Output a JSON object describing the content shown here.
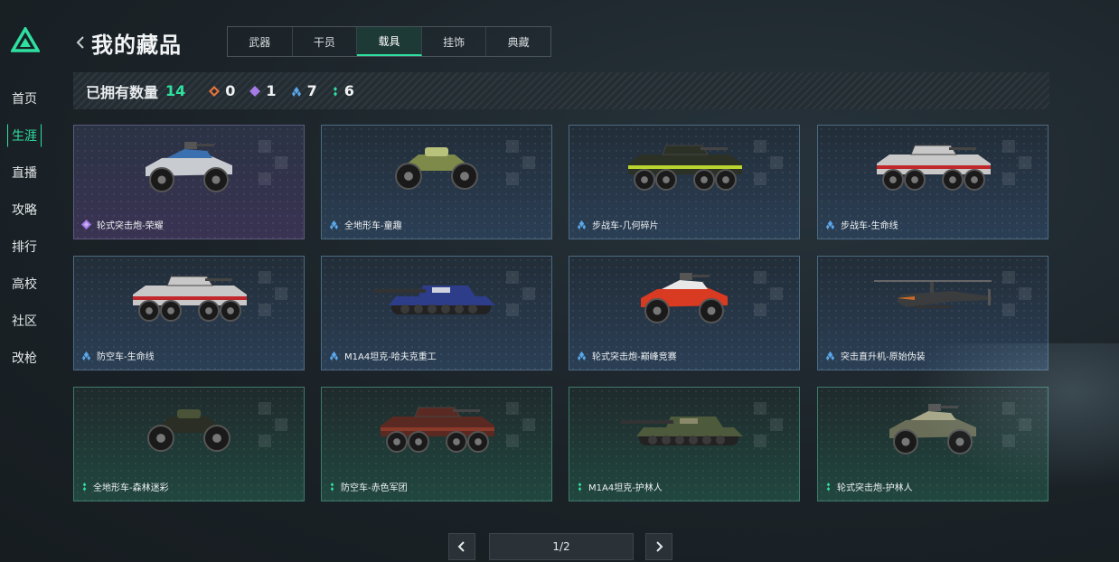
{
  "nav": {
    "items": [
      {
        "label": "首页",
        "active": false
      },
      {
        "label": "生涯",
        "active": true
      },
      {
        "label": "直播",
        "active": false
      },
      {
        "label": "攻略",
        "active": false
      },
      {
        "label": "排行",
        "active": false
      },
      {
        "label": "高校",
        "active": false
      },
      {
        "label": "社区",
        "active": false
      },
      {
        "label": "改枪",
        "active": false
      }
    ]
  },
  "header": {
    "title": "我的藏品",
    "tabs": [
      {
        "label": "武器",
        "active": false
      },
      {
        "label": "干员",
        "active": false
      },
      {
        "label": "载具",
        "active": true
      },
      {
        "label": "挂饰",
        "active": false
      },
      {
        "label": "典藏",
        "active": false
      }
    ]
  },
  "stats": {
    "label": "已拥有数量",
    "total": "14",
    "items": [
      {
        "rarity": "orange",
        "color": "#e8733a",
        "value": "0"
      },
      {
        "rarity": "purple",
        "color": "#a57be8",
        "value": "1"
      },
      {
        "rarity": "blue",
        "color": "#5aa6e8",
        "value": "7"
      },
      {
        "rarity": "green",
        "color": "#2fe0a0",
        "value": "6"
      }
    ]
  },
  "vehicles": [
    {
      "name": "轮式突击炮-荣耀",
      "rarity": "purple",
      "kind": "buggy",
      "body": "#c8ccd0",
      "accent": "#3a6fb0"
    },
    {
      "name": "全地形车-童趣",
      "rarity": "blue",
      "kind": "atv",
      "body": "#7d8a4a",
      "accent": "#b9c27a"
    },
    {
      "name": "步战车-几何碎片",
      "rarity": "blue",
      "kind": "ifv",
      "body": "#2c3126",
      "accent": "#b9d42f"
    },
    {
      "name": "步战车-生命线",
      "rarity": "blue",
      "kind": "ifv",
      "body": "#c8c8c8",
      "accent": "#c0282c"
    },
    {
      "name": "防空车-生命线",
      "rarity": "blue",
      "kind": "ifv",
      "body": "#c8c8c8",
      "accent": "#c0282c"
    },
    {
      "name": "M1A4坦克-哈夫克重工",
      "rarity": "blue",
      "kind": "tank",
      "body": "#2d3d8a",
      "accent": "#d0d4e0"
    },
    {
      "name": "轮式突击炮-巅峰竞赛",
      "rarity": "blue",
      "kind": "buggy",
      "body": "#d83a22",
      "accent": "#e8e8e8"
    },
    {
      "name": "突击直升机-原始伪装",
      "rarity": "blue",
      "kind": "heli",
      "body": "#3a3c3e",
      "accent": "#c86a2a"
    },
    {
      "name": "全地形车-森林迷彩",
      "rarity": "green",
      "kind": "atv",
      "body": "#2a2e24",
      "accent": "#4a5238"
    },
    {
      "name": "防空车-赤色军团",
      "rarity": "green",
      "kind": "ifv",
      "body": "#5a2a22",
      "accent": "#8a3a2a"
    },
    {
      "name": "M1A4坦克-护林人",
      "rarity": "green",
      "kind": "tank",
      "body": "#4e5a3c",
      "accent": "#8a8a6a"
    },
    {
      "name": "轮式突击炮-护林人",
      "rarity": "green",
      "kind": "buggy",
      "body": "#6a6e58",
      "accent": "#a8a888"
    }
  ],
  "pager": {
    "text": "1/2"
  }
}
